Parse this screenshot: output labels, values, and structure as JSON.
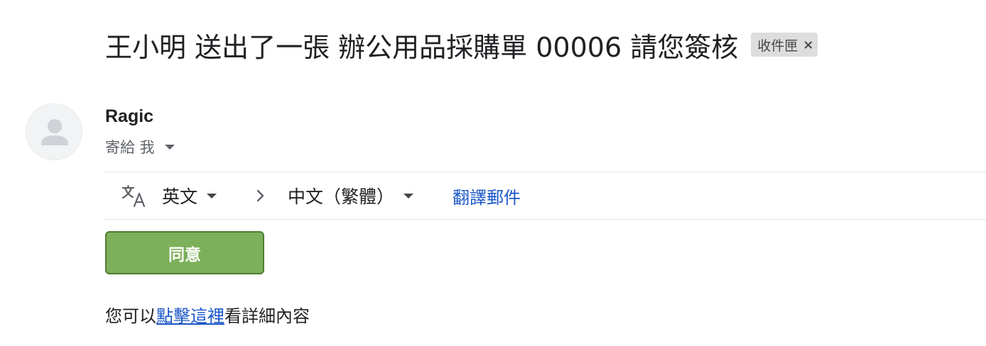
{
  "email": {
    "subject": "王小明 送出了一張 辦公用品採購單 00006 請您簽核",
    "label_chip": {
      "text": "收件匣",
      "close_glyph": "×"
    },
    "sender": {
      "name": "Ragic",
      "avatar_icon": "person-icon"
    },
    "recipient": {
      "text": "寄給 我"
    }
  },
  "translate_bar": {
    "icon": "translate-icon",
    "source_language": "英文",
    "target_language": "中文（繁體）",
    "translate_link": "翻譯郵件"
  },
  "body": {
    "approve_button": "同意",
    "text_before": "您可以",
    "link_text": "點擊這裡",
    "text_after": "看詳細內容"
  },
  "colors": {
    "approve_green": "#7cb05a",
    "link_blue": "#1a56c7"
  }
}
